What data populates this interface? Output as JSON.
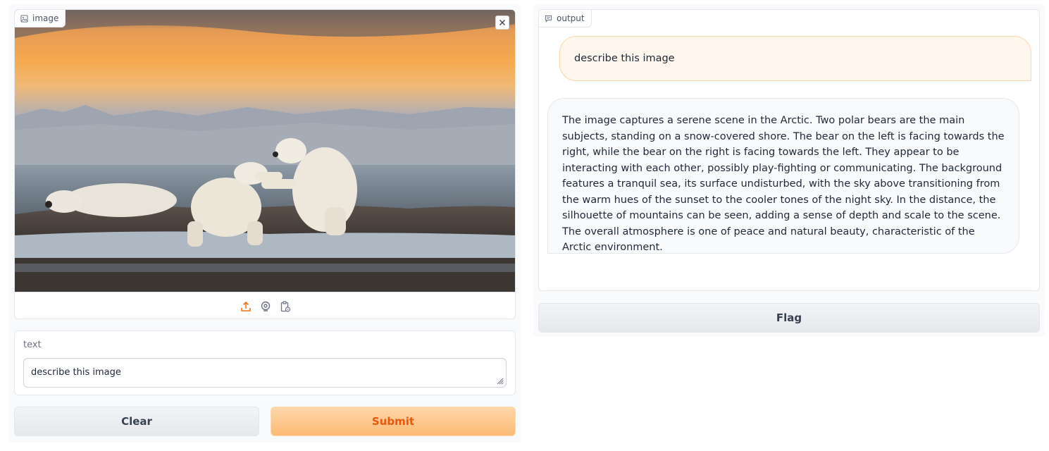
{
  "image_panel": {
    "label": "image",
    "source_icons": [
      "upload-icon",
      "webcam-icon",
      "clipboard-icon"
    ],
    "accent_color": "#f97316"
  },
  "text_panel": {
    "label": "text",
    "value": "describe this image"
  },
  "buttons": {
    "clear": "Clear",
    "submit": "Submit",
    "flag": "Flag"
  },
  "output_panel": {
    "label": "output",
    "messages": [
      {
        "role": "user",
        "text": "describe this image"
      },
      {
        "role": "bot",
        "text": "The image captures a serene scene in the Arctic. Two polar bears are the main subjects, standing on a snow-covered shore. The bear on the left is facing towards the right, while the bear on the right is facing towards the left. They appear to be interacting with each other, possibly play-fighting or communicating. The background features a tranquil sea, its surface undisturbed, with the sky above transitioning from the warm hues of the sunset to the cooler tones of the night sky. In the distance, the silhouette of mountains can be seen, adding a sense of depth and scale to the scene. The overall atmosphere is one of peace and natural beauty, characteristic of the Arctic environment."
      }
    ]
  },
  "colors": {
    "submit_text": "#ea580c",
    "submit_bg": "#fdba74",
    "user_bubble_bg": "#fff7ed"
  }
}
